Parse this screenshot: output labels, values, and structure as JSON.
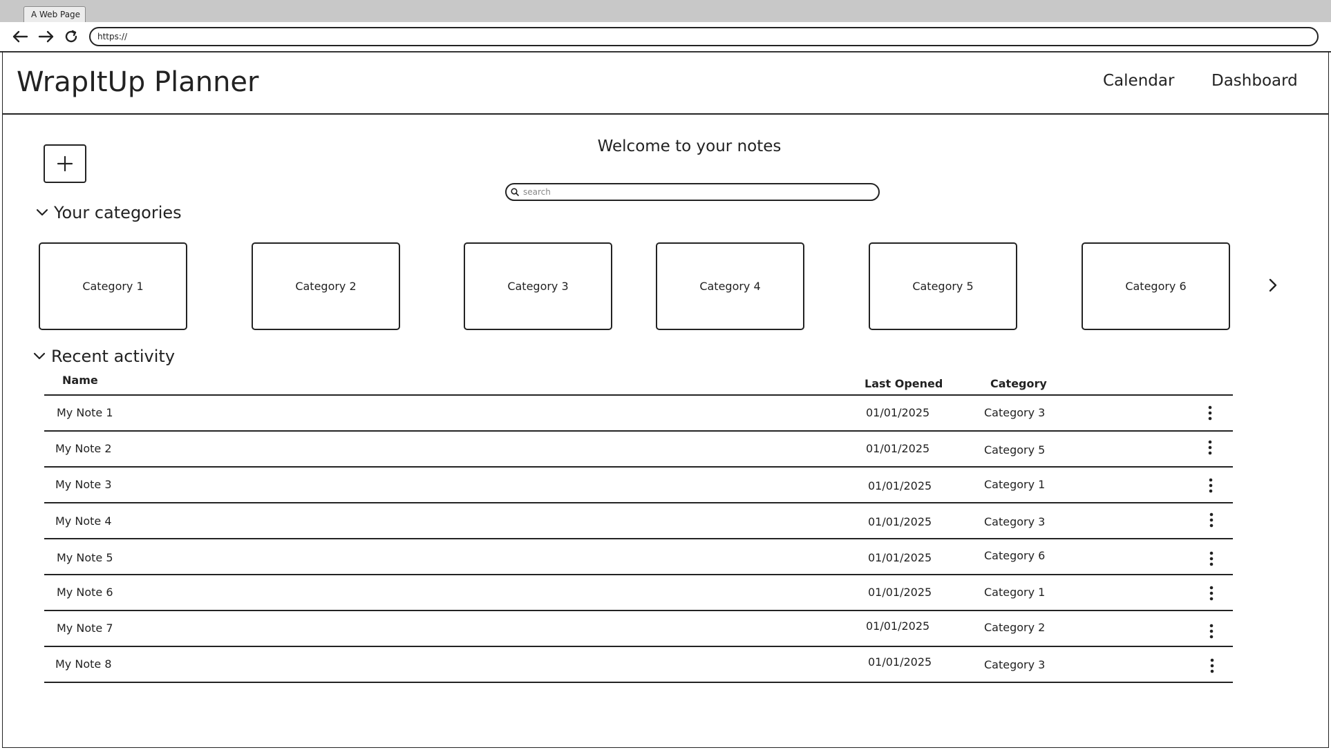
{
  "browser": {
    "tab_title": "A Web Page",
    "url": "https://"
  },
  "header": {
    "title": "WrapItUp Planner",
    "nav": [
      "Calendar",
      "Dashboard"
    ]
  },
  "main": {
    "welcome": "Welcome to your notes",
    "search_placeholder": "search",
    "categories_heading": "Your categories",
    "categories": [
      "Category 1",
      "Category 2",
      "Category 3",
      "Category 4",
      "Category 5",
      "Category 6"
    ],
    "recent_heading": "Recent activity",
    "columns": {
      "name": "Name",
      "last_opened": "Last Opened",
      "category": "Category"
    },
    "rows": [
      {
        "name": "My Note 1",
        "date": "01/01/2025",
        "category": "Category 3"
      },
      {
        "name": "My Note 2",
        "date": "01/01/2025",
        "category": "Category 5"
      },
      {
        "name": "My Note 3",
        "date": "01/01/2025",
        "category": "Category 1"
      },
      {
        "name": "My Note 4",
        "date": "01/01/2025",
        "category": "Category 3"
      },
      {
        "name": "My Note 5",
        "date": "01/01/2025",
        "category": "Category 6"
      },
      {
        "name": "My Note 6",
        "date": "01/01/2025",
        "category": "Category 1"
      },
      {
        "name": "My Note 7",
        "date": "01/01/2025",
        "category": "Category 2"
      },
      {
        "name": "My Note 8",
        "date": "01/01/2025",
        "category": "Category 3"
      }
    ]
  }
}
